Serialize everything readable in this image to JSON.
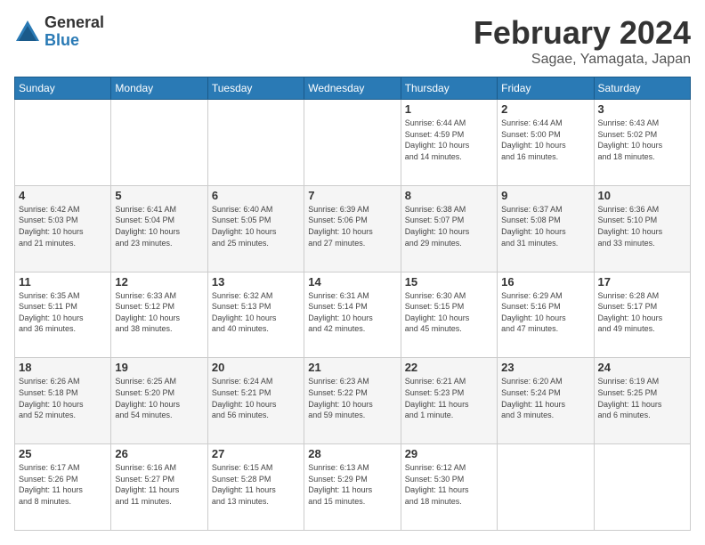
{
  "logo": {
    "general": "General",
    "blue": "Blue"
  },
  "title": "February 2024",
  "subtitle": "Sagae, Yamagata, Japan",
  "weekdays": [
    "Sunday",
    "Monday",
    "Tuesday",
    "Wednesday",
    "Thursday",
    "Friday",
    "Saturday"
  ],
  "weeks": [
    [
      {
        "day": "",
        "info": ""
      },
      {
        "day": "",
        "info": ""
      },
      {
        "day": "",
        "info": ""
      },
      {
        "day": "",
        "info": ""
      },
      {
        "day": "1",
        "info": "Sunrise: 6:44 AM\nSunset: 4:59 PM\nDaylight: 10 hours\nand 14 minutes."
      },
      {
        "day": "2",
        "info": "Sunrise: 6:44 AM\nSunset: 5:00 PM\nDaylight: 10 hours\nand 16 minutes."
      },
      {
        "day": "3",
        "info": "Sunrise: 6:43 AM\nSunset: 5:02 PM\nDaylight: 10 hours\nand 18 minutes."
      }
    ],
    [
      {
        "day": "4",
        "info": "Sunrise: 6:42 AM\nSunset: 5:03 PM\nDaylight: 10 hours\nand 21 minutes."
      },
      {
        "day": "5",
        "info": "Sunrise: 6:41 AM\nSunset: 5:04 PM\nDaylight: 10 hours\nand 23 minutes."
      },
      {
        "day": "6",
        "info": "Sunrise: 6:40 AM\nSunset: 5:05 PM\nDaylight: 10 hours\nand 25 minutes."
      },
      {
        "day": "7",
        "info": "Sunrise: 6:39 AM\nSunset: 5:06 PM\nDaylight: 10 hours\nand 27 minutes."
      },
      {
        "day": "8",
        "info": "Sunrise: 6:38 AM\nSunset: 5:07 PM\nDaylight: 10 hours\nand 29 minutes."
      },
      {
        "day": "9",
        "info": "Sunrise: 6:37 AM\nSunset: 5:08 PM\nDaylight: 10 hours\nand 31 minutes."
      },
      {
        "day": "10",
        "info": "Sunrise: 6:36 AM\nSunset: 5:10 PM\nDaylight: 10 hours\nand 33 minutes."
      }
    ],
    [
      {
        "day": "11",
        "info": "Sunrise: 6:35 AM\nSunset: 5:11 PM\nDaylight: 10 hours\nand 36 minutes."
      },
      {
        "day": "12",
        "info": "Sunrise: 6:33 AM\nSunset: 5:12 PM\nDaylight: 10 hours\nand 38 minutes."
      },
      {
        "day": "13",
        "info": "Sunrise: 6:32 AM\nSunset: 5:13 PM\nDaylight: 10 hours\nand 40 minutes."
      },
      {
        "day": "14",
        "info": "Sunrise: 6:31 AM\nSunset: 5:14 PM\nDaylight: 10 hours\nand 42 minutes."
      },
      {
        "day": "15",
        "info": "Sunrise: 6:30 AM\nSunset: 5:15 PM\nDaylight: 10 hours\nand 45 minutes."
      },
      {
        "day": "16",
        "info": "Sunrise: 6:29 AM\nSunset: 5:16 PM\nDaylight: 10 hours\nand 47 minutes."
      },
      {
        "day": "17",
        "info": "Sunrise: 6:28 AM\nSunset: 5:17 PM\nDaylight: 10 hours\nand 49 minutes."
      }
    ],
    [
      {
        "day": "18",
        "info": "Sunrise: 6:26 AM\nSunset: 5:18 PM\nDaylight: 10 hours\nand 52 minutes."
      },
      {
        "day": "19",
        "info": "Sunrise: 6:25 AM\nSunset: 5:20 PM\nDaylight: 10 hours\nand 54 minutes."
      },
      {
        "day": "20",
        "info": "Sunrise: 6:24 AM\nSunset: 5:21 PM\nDaylight: 10 hours\nand 56 minutes."
      },
      {
        "day": "21",
        "info": "Sunrise: 6:23 AM\nSunset: 5:22 PM\nDaylight: 10 hours\nand 59 minutes."
      },
      {
        "day": "22",
        "info": "Sunrise: 6:21 AM\nSunset: 5:23 PM\nDaylight: 11 hours\nand 1 minute."
      },
      {
        "day": "23",
        "info": "Sunrise: 6:20 AM\nSunset: 5:24 PM\nDaylight: 11 hours\nand 3 minutes."
      },
      {
        "day": "24",
        "info": "Sunrise: 6:19 AM\nSunset: 5:25 PM\nDaylight: 11 hours\nand 6 minutes."
      }
    ],
    [
      {
        "day": "25",
        "info": "Sunrise: 6:17 AM\nSunset: 5:26 PM\nDaylight: 11 hours\nand 8 minutes."
      },
      {
        "day": "26",
        "info": "Sunrise: 6:16 AM\nSunset: 5:27 PM\nDaylight: 11 hours\nand 11 minutes."
      },
      {
        "day": "27",
        "info": "Sunrise: 6:15 AM\nSunset: 5:28 PM\nDaylight: 11 hours\nand 13 minutes."
      },
      {
        "day": "28",
        "info": "Sunrise: 6:13 AM\nSunset: 5:29 PM\nDaylight: 11 hours\nand 15 minutes."
      },
      {
        "day": "29",
        "info": "Sunrise: 6:12 AM\nSunset: 5:30 PM\nDaylight: 11 hours\nand 18 minutes."
      },
      {
        "day": "",
        "info": ""
      },
      {
        "day": "",
        "info": ""
      }
    ]
  ]
}
